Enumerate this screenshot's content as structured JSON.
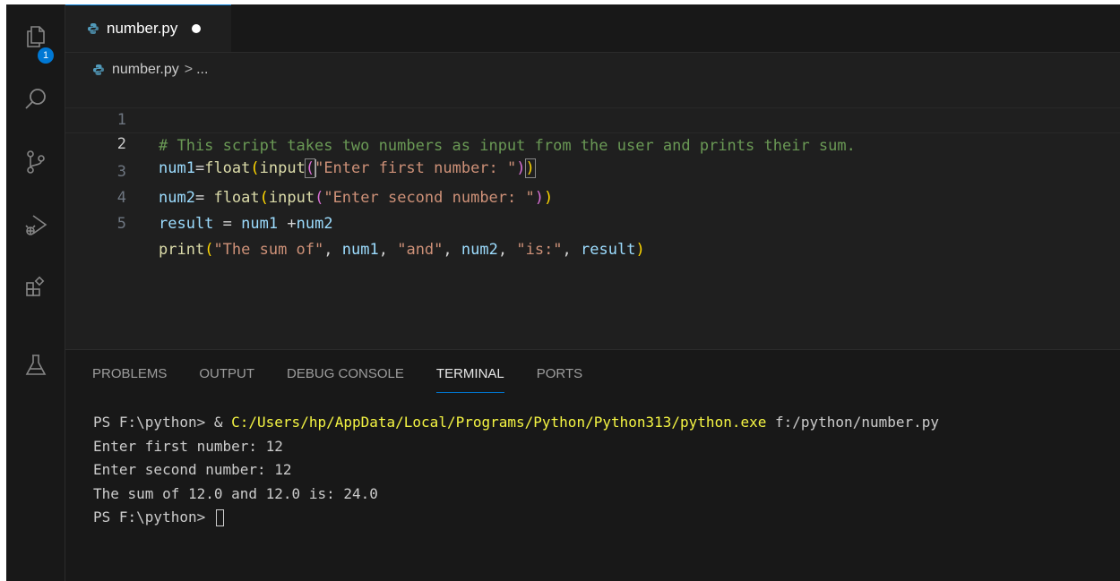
{
  "tab": {
    "filename": "number.py"
  },
  "breadcrumb": {
    "file": "number.py",
    "separator": ">",
    "more": "..."
  },
  "activity": {
    "explorer_badge": "1"
  },
  "editor": {
    "lines": [
      {
        "number": "1",
        "text": "# This script takes two numbers as input from the user and prints their sum."
      },
      {
        "number": "2",
        "text": "num1=float(input(\"Enter first number: \"))"
      },
      {
        "number": "3",
        "text": "num2= float(input(\"Enter second number: \"))"
      },
      {
        "number": "4",
        "text": "result = num1 +num2"
      },
      {
        "number": "5",
        "text": "print(\"The sum of\", num1, \"and\", num2, \"is:\", result)"
      }
    ]
  },
  "panel": {
    "tabs": [
      "PROBLEMS",
      "OUTPUT",
      "DEBUG CONSOLE",
      "TERMINAL",
      "PORTS"
    ],
    "active_tab": "TERMINAL"
  },
  "terminal": {
    "cmd_prompt": "PS F:\\python> ",
    "cmd_amp": "& ",
    "cmd_exe": "C:/Users/hp/AppData/Local/Programs/Python/Python313/python.exe",
    "cmd_arg": " f:/python/number.py",
    "out1": "Enter first number: 12",
    "out2": "Enter second number: 12",
    "out3": "The sum of 12.0 and 12.0 is: 24.0",
    "final_prompt": "PS F:\\python> "
  },
  "colors": {
    "accent": "#0078d4",
    "comment": "#6a9955",
    "string": "#ce9178",
    "variable": "#9cdcfe",
    "function": "#dcdcaa",
    "terminal_path": "#f5f543"
  }
}
